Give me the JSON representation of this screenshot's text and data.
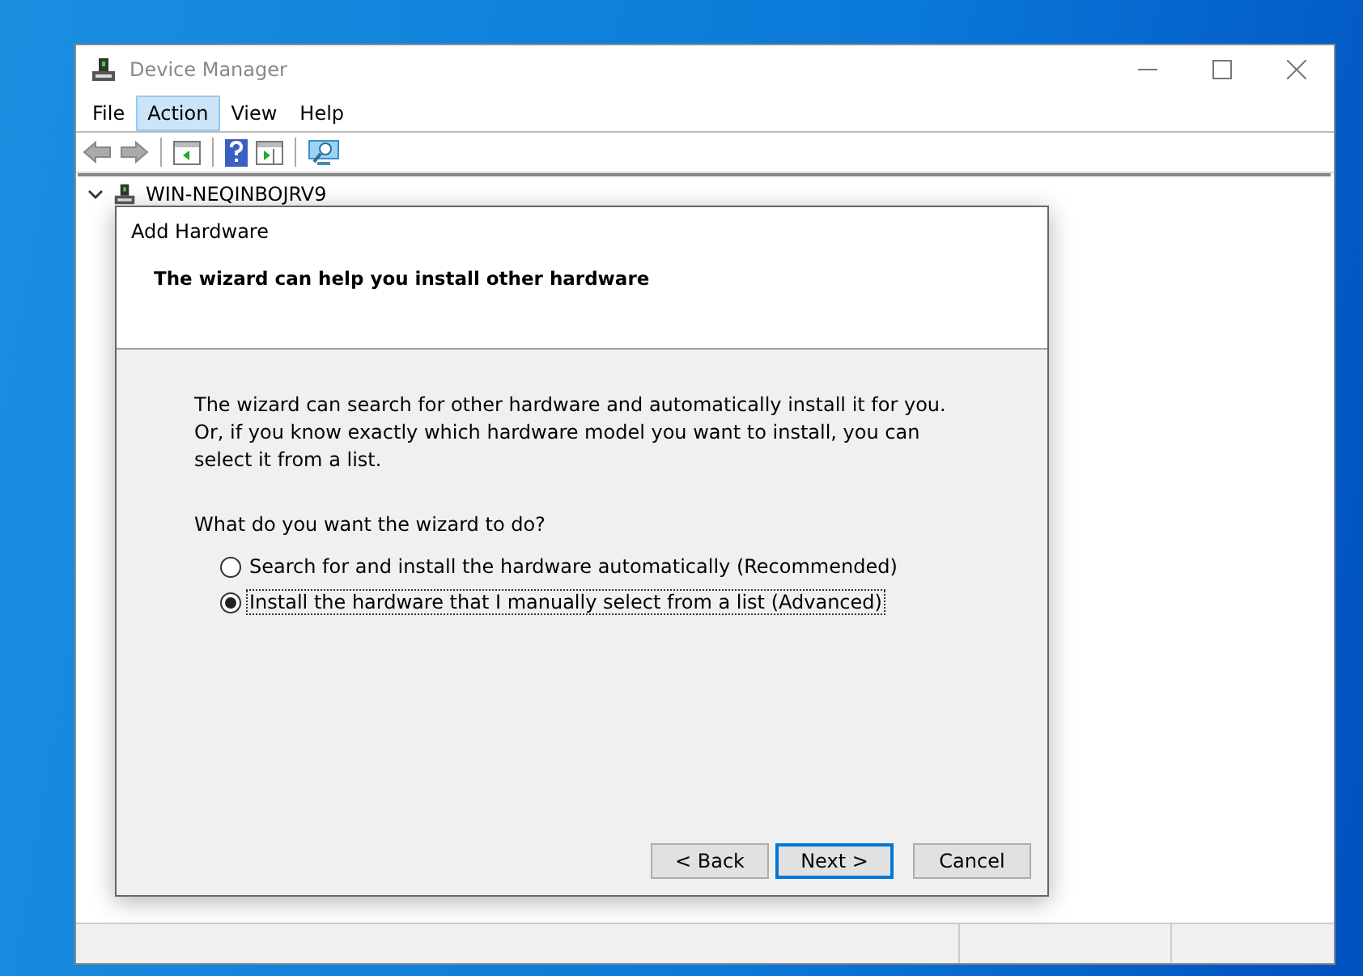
{
  "window": {
    "title": "Device Manager"
  },
  "menu": [
    {
      "label": "File",
      "selected": false
    },
    {
      "label": "Action",
      "selected": true
    },
    {
      "label": "View",
      "selected": false
    },
    {
      "label": "Help",
      "selected": false
    }
  ],
  "tree": {
    "label": "WIN-NEQINBOJRV9",
    "expanded": true
  },
  "dialog": {
    "title": "Add Hardware",
    "heading": "The wizard can help you install other hardware",
    "description": "The wizard can search for other hardware and automatically install it for you. Or, if you know exactly which hardware model you want to install, you can select it from a list.",
    "question": "What do you want the wizard to do?",
    "options": [
      {
        "label": "Search for and install the hardware automatically (Recommended)",
        "selected": false
      },
      {
        "label": "Install the hardware that I manually select from a list (Advanced)",
        "selected": true
      }
    ],
    "buttons": [
      {
        "label": "< Back",
        "default": false
      },
      {
        "label": "Next >",
        "default": true
      },
      {
        "label": "Cancel",
        "default": false
      }
    ]
  }
}
